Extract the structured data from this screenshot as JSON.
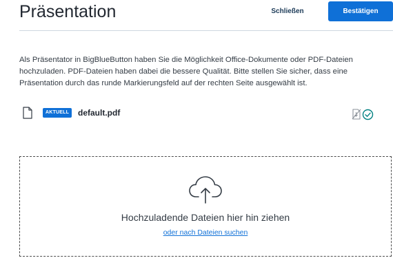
{
  "header": {
    "title": "Präsentation",
    "close_label": "Schließen",
    "confirm_label": "Bestätigen"
  },
  "description": "Als Präsentator in BigBlueButton haben Sie die Möglichkeit Office-Dokumente oder PDF-Dateien hochzuladen. PDF-Dateien haben dabei die bessere Qualität. Bitte stellen Sie sicher, dass eine Präsentation durch das runde Markierungsfeld auf der rechten Seite ausgewählt ist.",
  "files": [
    {
      "badge": "AKTUELL",
      "name": "default.pdf",
      "icons": [
        "file-icon",
        "download-disabled-icon",
        "selected-check-icon"
      ]
    }
  ],
  "dropzone": {
    "icon": "cloud-upload-icon",
    "text": "Hochzuladende Dateien hier hin ziehen",
    "link": "oder nach Dateien suchen"
  },
  "colors": {
    "accent": "#0f70d7",
    "success": "#008081",
    "text": "#222831"
  }
}
